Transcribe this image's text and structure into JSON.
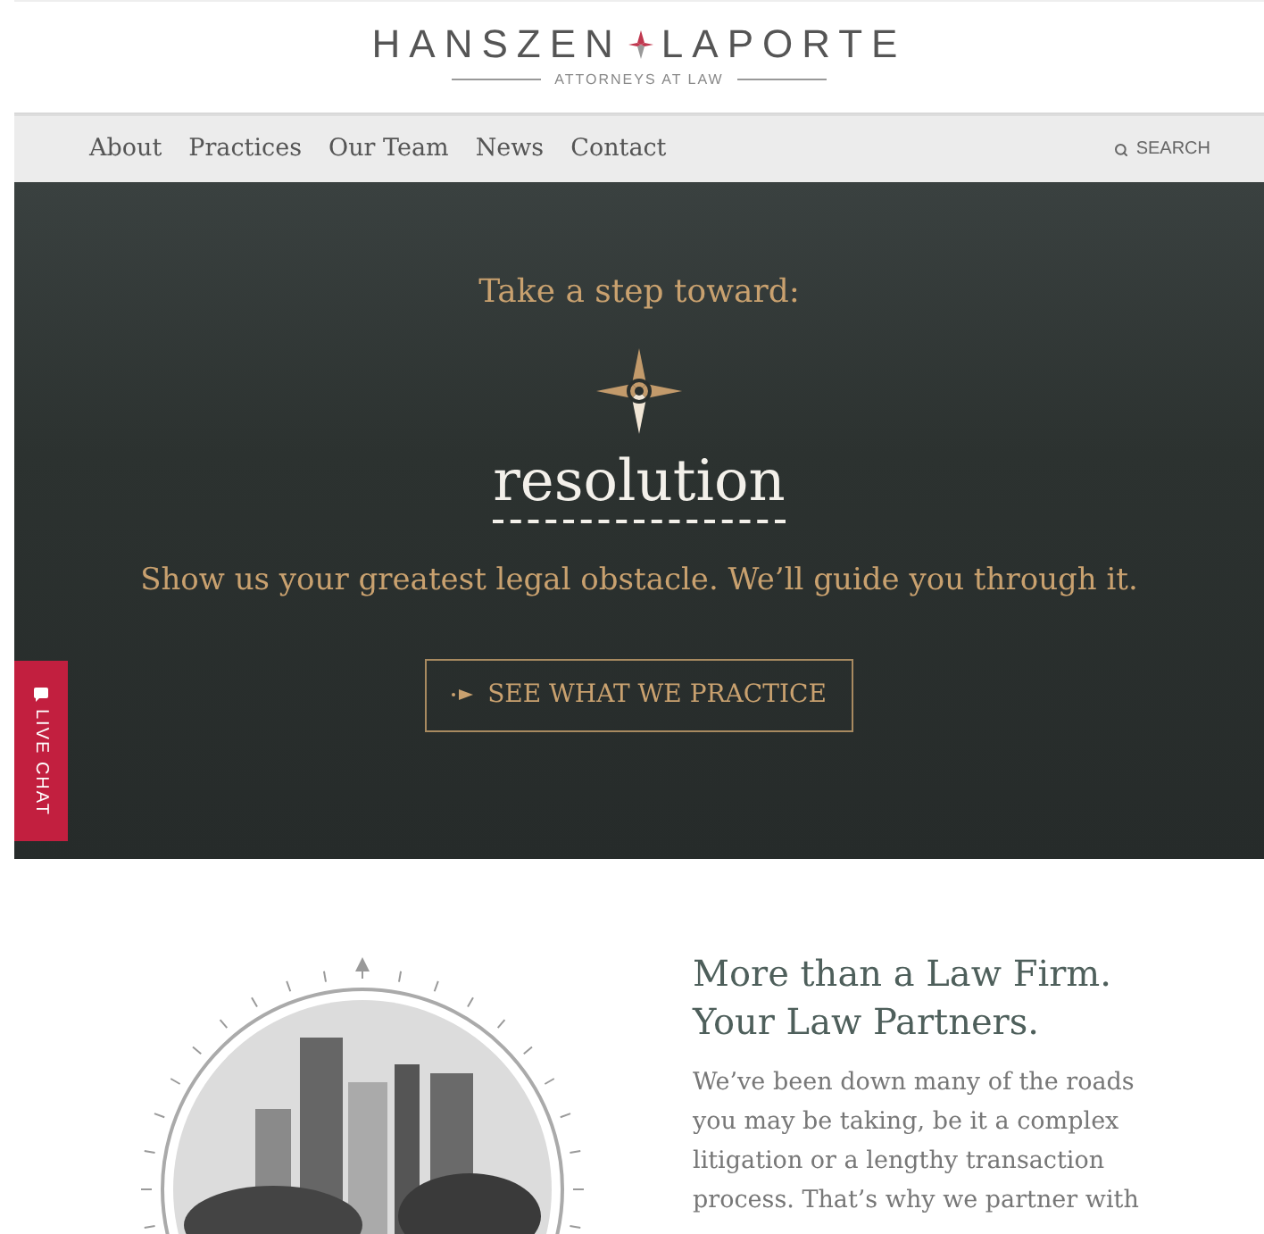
{
  "logo": {
    "left": "HANSZEN",
    "right": "LAPORTE",
    "tagline": "ATTORNEYS AT LAW"
  },
  "nav": {
    "items": [
      {
        "label": "About"
      },
      {
        "label": "Practices"
      },
      {
        "label": "Our Team"
      },
      {
        "label": "News"
      },
      {
        "label": "Contact"
      }
    ],
    "search": "SEARCH"
  },
  "hero": {
    "kicker": "Take a step toward:",
    "word": "resolution",
    "tagline": "Show us your greatest legal obstacle. We’ll guide you through it.",
    "button": "SEE WHAT WE PRACTICE"
  },
  "live_chat": "LIVE CHAT",
  "intro": {
    "heading_lines": [
      "More than a Law Firm.",
      "Your Law Partners."
    ],
    "body": "We’ve been down many of the roads you may be taking, be it a complex litigation or a lengthy transaction process. That’s why we partner with"
  }
}
